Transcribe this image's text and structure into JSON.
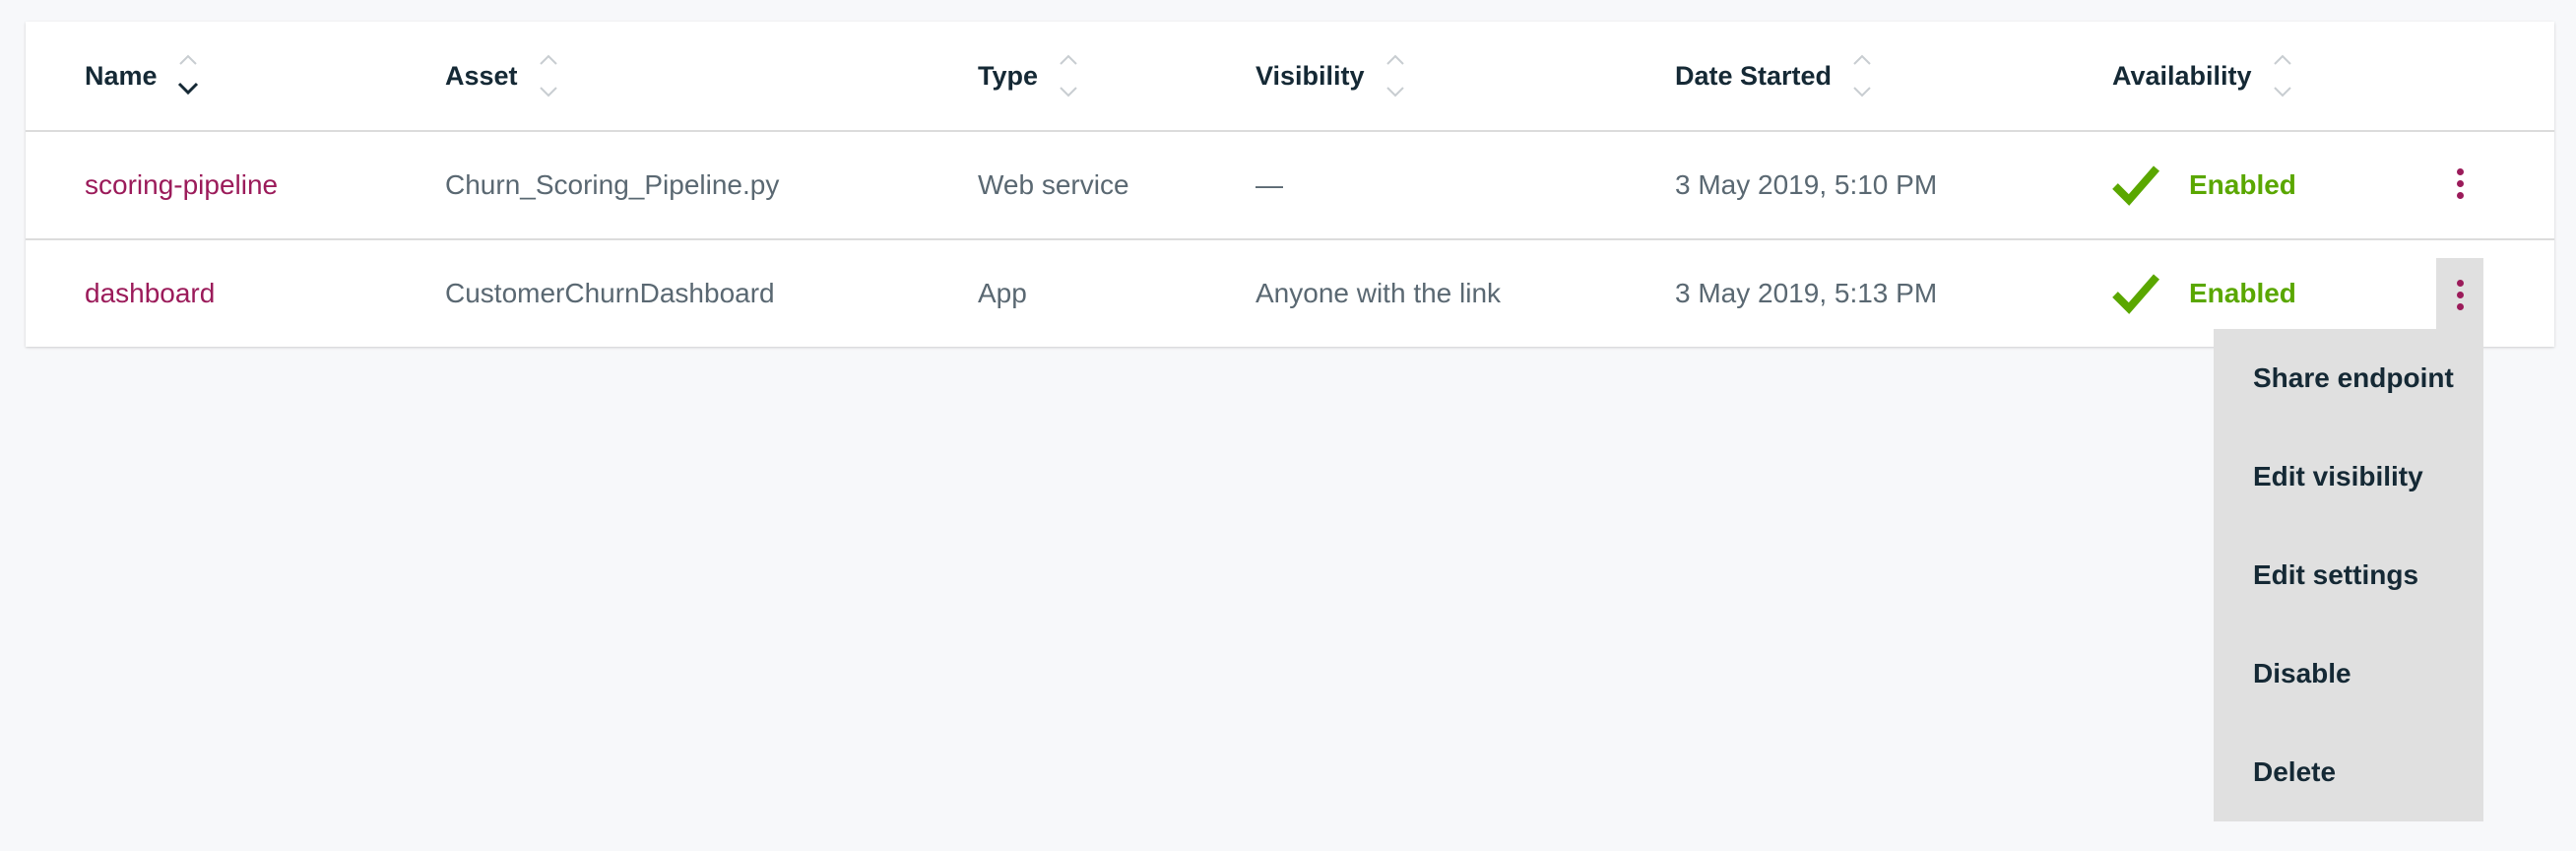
{
  "table": {
    "columns": [
      {
        "label": "Name",
        "sort": "descending"
      },
      {
        "label": "Asset",
        "sort": "none"
      },
      {
        "label": "Type",
        "sort": "none"
      },
      {
        "label": "Visibility",
        "sort": "none"
      },
      {
        "label": "Date Started",
        "sort": "none"
      },
      {
        "label": "Availability",
        "sort": "none"
      }
    ],
    "rows": [
      {
        "name": "scoring-pipeline",
        "asset": "Churn_Scoring_Pipeline.py",
        "type": "Web service",
        "visibility": "—",
        "date_started": "3 May 2019, 5:10 PM",
        "availability": "Enabled"
      },
      {
        "name": "dashboard",
        "asset": "CustomerChurnDashboard",
        "type": "App",
        "visibility": "Anyone with the link",
        "date_started": "3 May 2019, 5:13 PM",
        "availability": "Enabled"
      }
    ]
  },
  "overflow_menu": {
    "items": [
      "Share endpoint",
      "Edit visibility",
      "Edit settings",
      "Disable",
      "Delete"
    ]
  },
  "colors": {
    "link": "#9b1b5a",
    "enabled": "#5aa700",
    "header_text": "#152935",
    "body_text": "#5a6872",
    "menu_bg": "#e0e0e0",
    "page_bg": "#f7f8fa"
  },
  "icons": {
    "sort": "sort-arrows-icon",
    "status": "checkmark-icon",
    "overflow": "overflow-menu-vertical-icon"
  }
}
